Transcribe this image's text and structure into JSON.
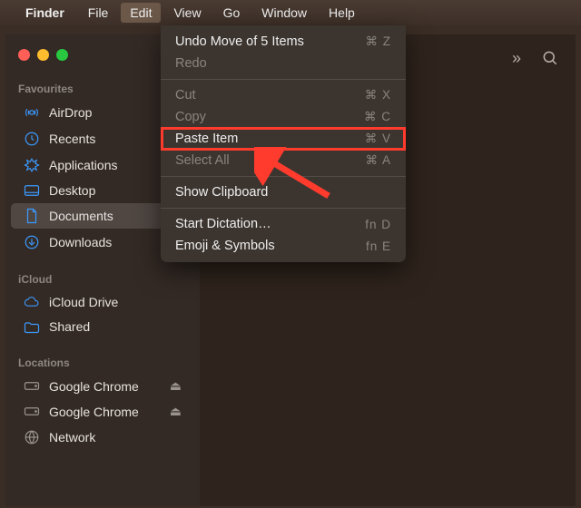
{
  "menubar": {
    "app_name": "Finder",
    "items": [
      "File",
      "Edit",
      "View",
      "Go",
      "Window",
      "Help"
    ],
    "active": "Edit"
  },
  "sidebar": {
    "sections": [
      {
        "label": "Favourites",
        "items": [
          {
            "icon": "airdrop",
            "label": "AirDrop"
          },
          {
            "icon": "recents",
            "label": "Recents"
          },
          {
            "icon": "applications",
            "label": "Applications"
          },
          {
            "icon": "desktop",
            "label": "Desktop"
          },
          {
            "icon": "documents",
            "label": "Documents",
            "selected": true
          },
          {
            "icon": "downloads",
            "label": "Downloads"
          }
        ]
      },
      {
        "label": "iCloud",
        "items": [
          {
            "icon": "icloud",
            "label": "iCloud Drive"
          },
          {
            "icon": "shared",
            "label": "Shared"
          }
        ]
      },
      {
        "label": "Locations",
        "items": [
          {
            "icon": "disk",
            "label": "Google Chrome",
            "eject": true
          },
          {
            "icon": "disk",
            "label": "Google Chrome",
            "eject": true
          },
          {
            "icon": "network",
            "label": "Network"
          }
        ]
      }
    ]
  },
  "edit_menu": {
    "groups": [
      [
        {
          "label": "Undo Move of 5 Items",
          "shortcut": "⌘ Z",
          "enabled": true
        },
        {
          "label": "Redo",
          "shortcut": "",
          "enabled": false
        }
      ],
      [
        {
          "label": "Cut",
          "shortcut": "⌘ X",
          "enabled": false
        },
        {
          "label": "Copy",
          "shortcut": "⌘ C",
          "enabled": false
        },
        {
          "label": "Paste Item",
          "shortcut": "⌘ V",
          "enabled": true,
          "highlight": true
        },
        {
          "label": "Select All",
          "shortcut": "⌘ A",
          "enabled": false
        }
      ],
      [
        {
          "label": "Show Clipboard",
          "shortcut": "",
          "enabled": true
        }
      ],
      [
        {
          "label": "Start Dictation…",
          "shortcut": "fn D",
          "enabled": true
        },
        {
          "label": "Emoji & Symbols",
          "shortcut": "fn E",
          "enabled": true
        }
      ]
    ]
  }
}
